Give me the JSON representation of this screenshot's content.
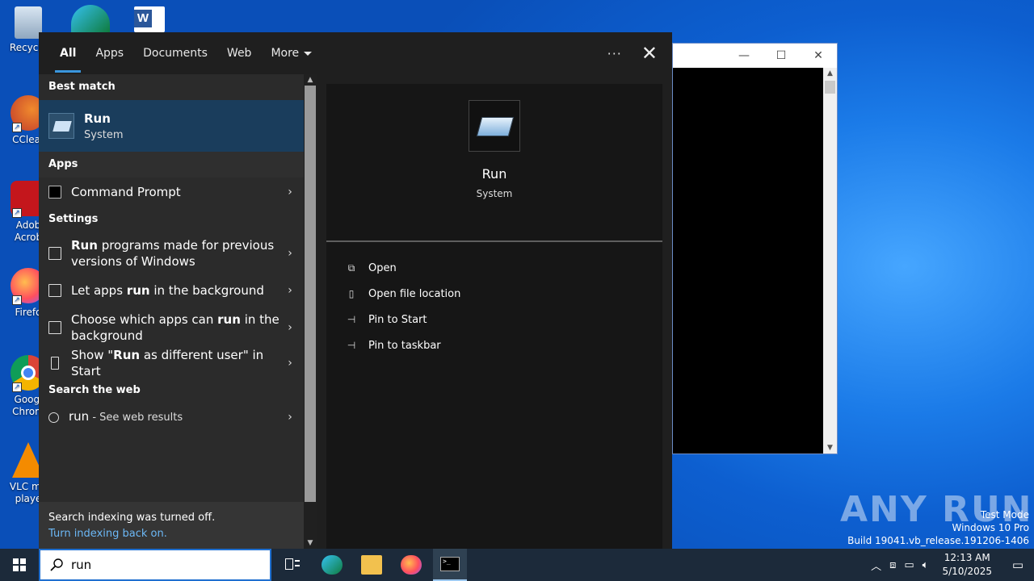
{
  "desktop": {
    "icons": [
      {
        "label": "Recycle",
        "icon": "recycle-bin-icon"
      },
      {
        "label": "CClear",
        "icon": "ccleaner-icon"
      },
      {
        "label": "Adob Acrob",
        "icon": "acrobat-icon"
      },
      {
        "label": "Firefo",
        "icon": "firefox-icon"
      },
      {
        "label": "Googl Chrom",
        "icon": "chrome-icon"
      },
      {
        "label": "VLC me playe",
        "icon": "vlc-icon"
      }
    ]
  },
  "search": {
    "tabs": [
      "All",
      "Apps",
      "Documents",
      "Web",
      "More"
    ],
    "best_match_header": "Best match",
    "best_match": {
      "title": "Run",
      "subtitle": "System"
    },
    "apps_header": "Apps",
    "apps": [
      {
        "label": "Command Prompt"
      }
    ],
    "settings_header": "Settings",
    "settings": [
      {
        "pre": "",
        "bold": "Run",
        "post": " programs made for previous versions of Windows"
      },
      {
        "pre": "Let apps ",
        "bold": "run",
        "post": " in the background"
      },
      {
        "pre": "Choose which apps can ",
        "bold": "run",
        "post": " in the background"
      },
      {
        "pre": "Show \"",
        "bold": "Run",
        "post": " as different user\" in Start"
      }
    ],
    "web_header": "Search the web",
    "web_result": {
      "query": "run",
      "suffix": " - See web results"
    },
    "footer_text": "Search indexing was turned off.",
    "footer_link": "Turn indexing back on.",
    "detail": {
      "title": "Run",
      "subtitle": "System",
      "actions": [
        "Open",
        "Open file location",
        "Pin to Start",
        "Pin to taskbar"
      ]
    }
  },
  "taskbar": {
    "search_value": "run",
    "time": "12:13 AM",
    "date": "5/10/2025"
  },
  "watermark": {
    "brand": "ANY RUN",
    "line1": "Test Mode",
    "line2": "Windows 10 Pro",
    "line3": "Build 19041.vb_release.191206-1406"
  }
}
